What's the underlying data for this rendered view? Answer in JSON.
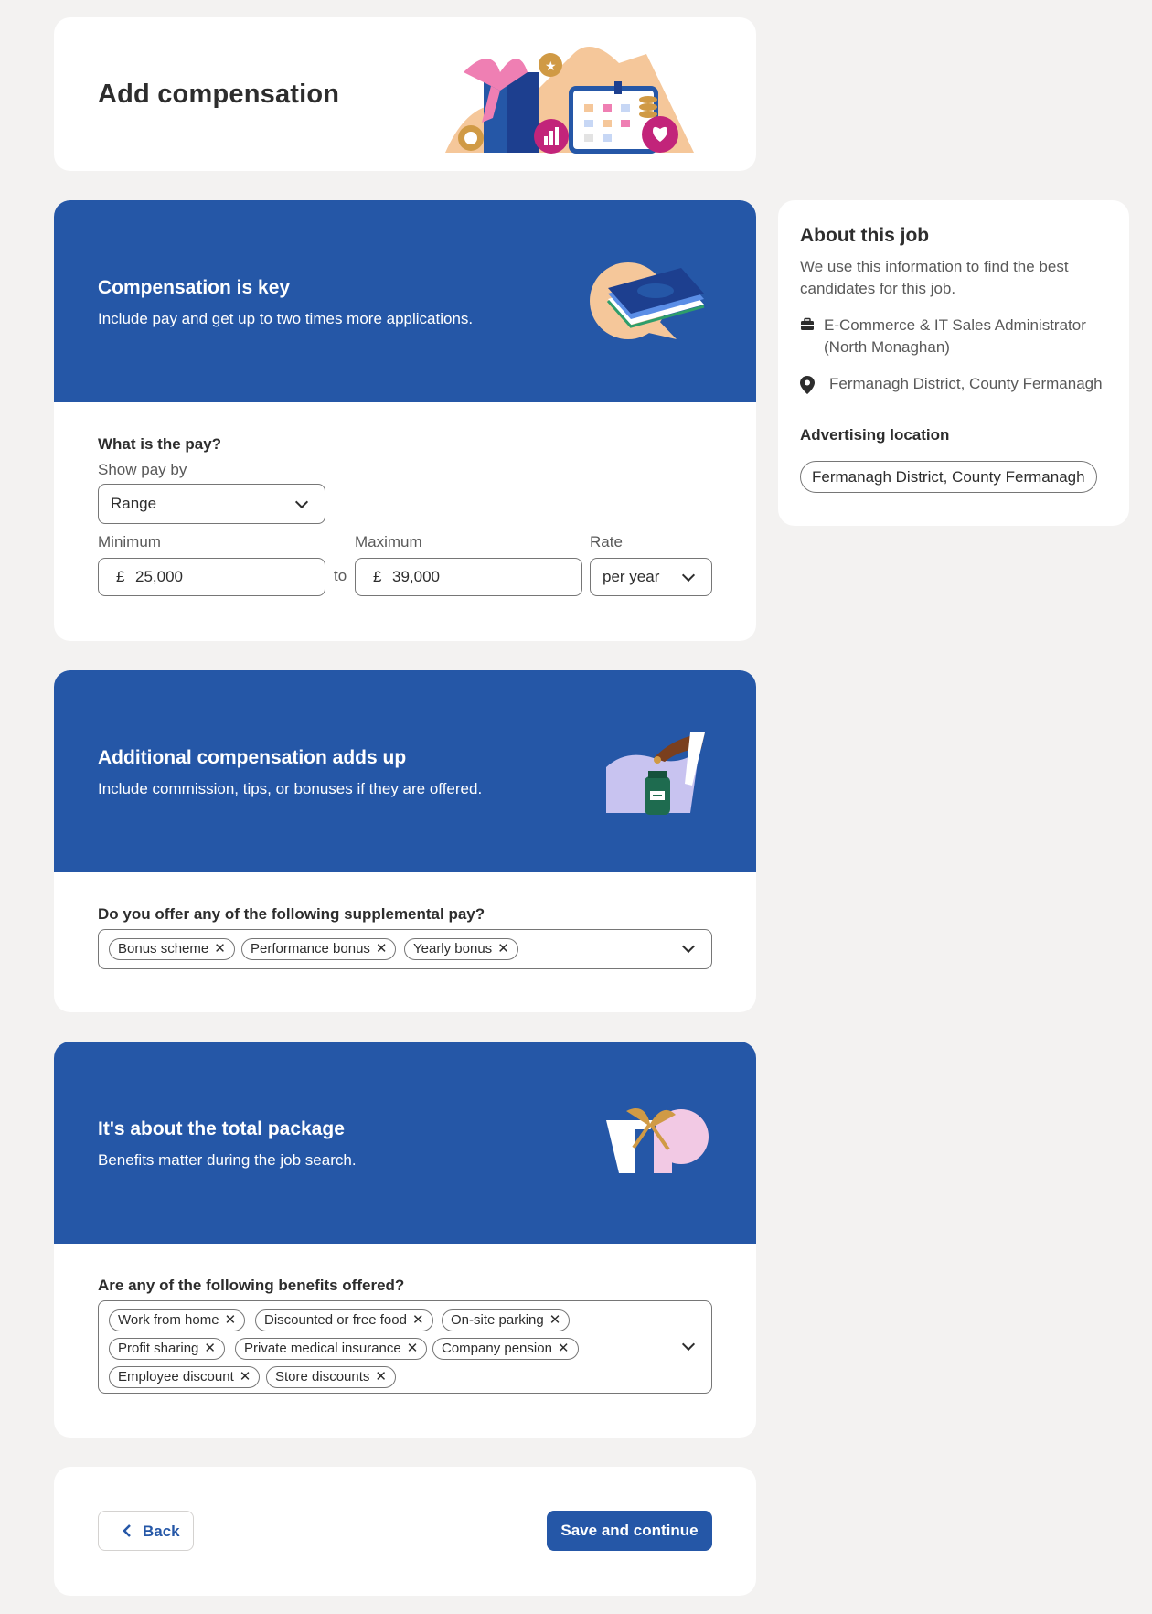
{
  "header": {
    "title": "Add compensation"
  },
  "pay_section": {
    "banner_title": "Compensation is key",
    "banner_subtitle": "Include pay and get up to two times more applications.",
    "question": "What is the pay?",
    "show_pay_by_label": "Show pay by",
    "show_pay_by_value": "Range",
    "minimum_label": "Minimum",
    "maximum_label": "Maximum",
    "rate_label": "Rate",
    "currency_symbol": "£",
    "minimum_value": "25,000",
    "maximum_value": "39,000",
    "to_label": "to",
    "rate_value": "per year"
  },
  "supplemental_section": {
    "banner_title": "Additional compensation adds up",
    "banner_subtitle": "Include commission, tips, or bonuses if they are offered.",
    "question": "Do you offer any of the following supplemental pay?",
    "selected": [
      "Bonus scheme",
      "Performance bonus",
      "Yearly bonus"
    ]
  },
  "benefits_section": {
    "banner_title": "It's about the total package",
    "banner_subtitle": "Benefits matter during the job search.",
    "question": "Are any of the following benefits offered?",
    "selected": [
      "Work from home",
      "Discounted or free food",
      "On-site parking",
      "Profit sharing",
      "Private medical insurance",
      "Company pension",
      "Employee discount",
      "Store discounts"
    ]
  },
  "footer": {
    "back_label": "Back",
    "save_label": "Save and continue"
  },
  "sidebar": {
    "title": "About this job",
    "description": "We use this information to find the best candidates for this job.",
    "job_title": "E-Commerce & IT Sales Administrator (North Monaghan)",
    "location": "Fermanagh District, County Fermanagh",
    "advertising_label": "Advertising location",
    "advertising_location": "Fermanagh District, County Fermanagh"
  },
  "colors": {
    "brand_blue": "#2557a7",
    "page_bg": "#f3f2f1",
    "border": "#767676"
  }
}
